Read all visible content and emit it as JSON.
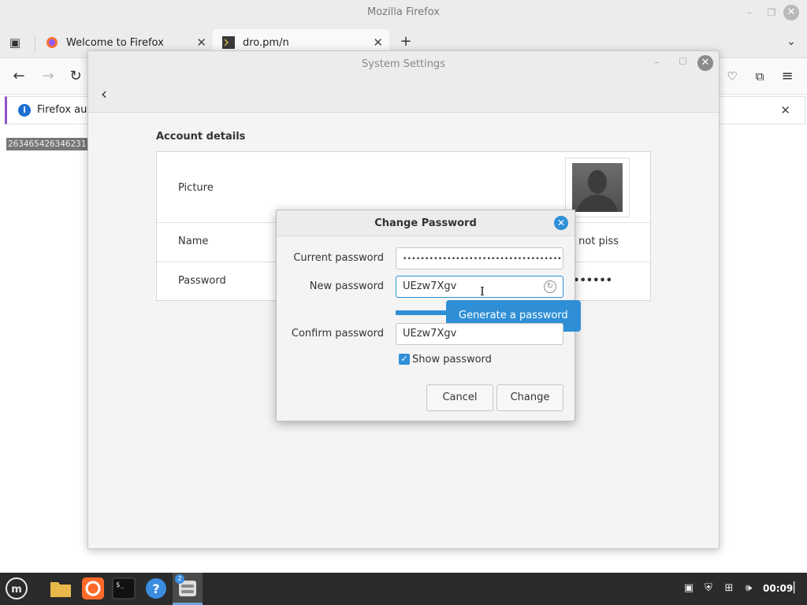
{
  "firefox": {
    "window_title": "Mozilla Firefox",
    "tabs": [
      {
        "label": "Welcome to Firefox",
        "icon": "firefox-icon"
      },
      {
        "label": "dro.pm/n",
        "icon": "terminal-icon"
      }
    ],
    "notification_text": "Firefox aut",
    "page_text": "263465426346231"
  },
  "settings": {
    "window_title": "System Settings",
    "section_title": "Account details",
    "rows": [
      {
        "label": "Picture",
        "value": ""
      },
      {
        "label": "Name",
        "value": "e not piss"
      },
      {
        "label": "Password",
        "value": "••••••"
      }
    ]
  },
  "dialog": {
    "title": "Change Password",
    "current_label": "Current password",
    "current_value": "••••••••••••••••••••••••••••••••••••••••",
    "new_label": "New password",
    "new_value": "UEzw7Xgv",
    "tooltip": "Generate a password",
    "confirm_label": "Confirm password",
    "confirm_value": "UEzw7Xgv",
    "show_password_label": "Show password",
    "show_password_checked": true,
    "cancel_label": "Cancel",
    "change_label": "Change"
  },
  "taskbar": {
    "clock": "00:09",
    "workspace_badge": "2"
  },
  "colors": {
    "accent": "#2f8fd6",
    "taskbar": "#2b2b2b"
  }
}
